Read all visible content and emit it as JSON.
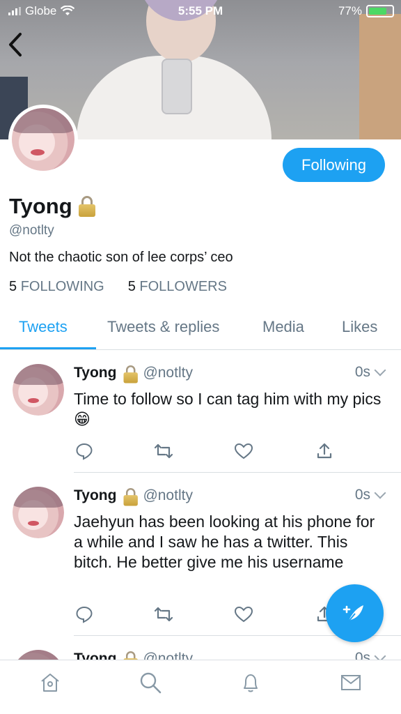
{
  "status_bar": {
    "carrier": "Globe",
    "time": "5:55 PM",
    "battery": "77%",
    "battery_level": 0.77
  },
  "profile": {
    "name": "Tyong",
    "handle": "@notlty",
    "bio": "Not the chaotic son of lee corps’ ceo",
    "following_count": "5",
    "following_label": "FOLLOWING",
    "followers_count": "5",
    "followers_label": "FOLLOWERS",
    "follow_button": "Following"
  },
  "tabs": [
    {
      "label": "Tweets",
      "active": true
    },
    {
      "label": "Tweets & replies",
      "active": false
    },
    {
      "label": "Media",
      "active": false
    },
    {
      "label": "Likes",
      "active": false
    }
  ],
  "tweets": [
    {
      "name": "Tyong",
      "handle": "@notlty",
      "time": "0s",
      "text": "Time to follow so I can tag him with my pics 😁"
    },
    {
      "name": "Tyong",
      "handle": "@notlty",
      "time": "0s",
      "text": "Jaehyun has been looking at his phone for a while and I saw he has a twitter. This bitch. He better give me his username"
    },
    {
      "name": "Tyong",
      "handle": "@notlty",
      "time": "0s",
      "text": ""
    }
  ],
  "colors": {
    "accent": "#1da1f2",
    "muted": "#657786",
    "divider": "#d9dee2"
  },
  "icons": {
    "back": "back-arrow-icon",
    "reply": "reply-icon",
    "retweet": "retweet-icon",
    "like": "heart-icon",
    "share": "share-icon",
    "compose": "compose-feather-icon",
    "home": "home-icon",
    "search": "search-icon",
    "notifications": "bell-icon",
    "messages": "mail-icon"
  }
}
